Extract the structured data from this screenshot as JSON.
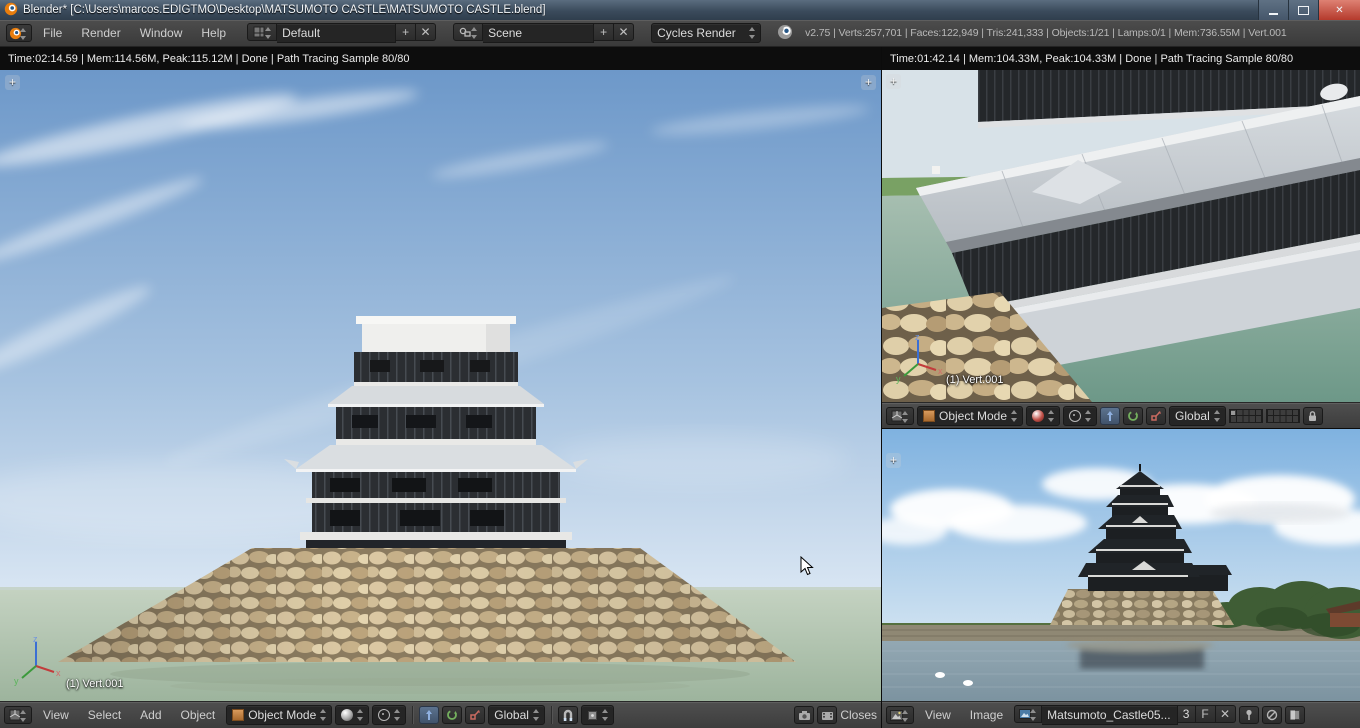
{
  "icons": {
    "plus": "+",
    "close": "✕"
  },
  "colors": {
    "header_bg": "#3f3f3f",
    "status_bar_bg": "#0d0d0d",
    "close_button": "#b53a2c",
    "blender_orange": "#e87d0d",
    "highlight_blue": "#41536b"
  },
  "window": {
    "title": "Blender* [C:\\Users\\marcos.EDIGTMO\\Desktop\\MATSUMOTO CASTLE\\MATSUMOTO CASTLE.blend]"
  },
  "topbar": {
    "menus": [
      "File",
      "Render",
      "Window",
      "Help"
    ],
    "layout": "Default",
    "scene": "Scene",
    "engine": "Cycles Render",
    "stats": "v2.75 | Verts:257,701 | Faces:122,949 | Tris:241,333 | Objects:1/21 | Lamps:0/1 | Mem:736.55M | Vert.001"
  },
  "main_viewport": {
    "render_status": "Time:02:14.59 | Mem:114.56M, Peak:115.12M | Done | Path Tracing Sample 80/80",
    "object_label": "(1) Vert.001",
    "header": {
      "menus": [
        "View",
        "Select",
        "Add",
        "Object"
      ],
      "mode": "Object Mode",
      "orientation": "Global",
      "snap_target": "Closes"
    }
  },
  "secondary_viewport": {
    "render_status": "Time:01:42.14 | Mem:104.33M, Peak:104.33M | Done | Path Tracing Sample 80/80",
    "object_label": "(1) Vert.001",
    "header": {
      "mode": "Object Mode",
      "orientation": "Global"
    }
  },
  "image_editor": {
    "header": {
      "menus": [
        "View",
        "Image"
      ],
      "image_name": "Matsumoto_Castle05...",
      "frame": "3",
      "fake_user": "F"
    }
  },
  "gizmo": {
    "x": "x",
    "y": "y",
    "z": "z"
  }
}
